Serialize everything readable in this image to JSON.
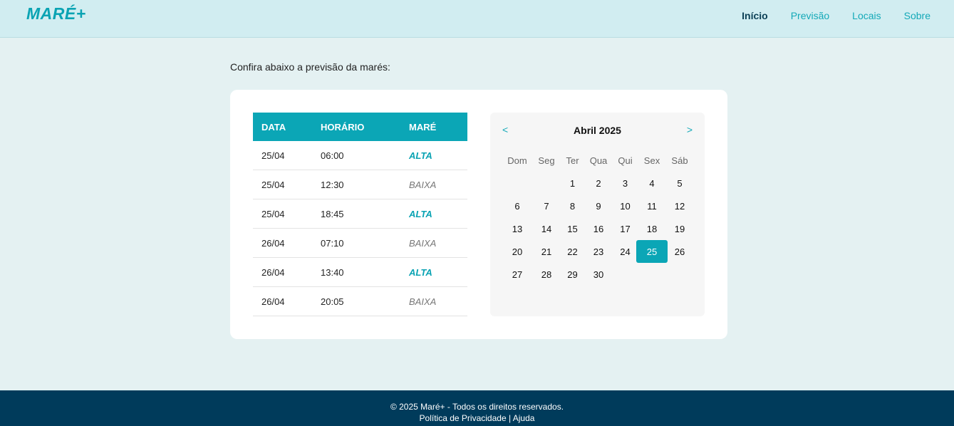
{
  "header": {
    "logo": "MARÉ+",
    "nav": [
      "Início",
      "Previsão",
      "Locais",
      "Sobre"
    ]
  },
  "intro": "Confira abaixo a previsão da marés:",
  "table": {
    "headers": [
      "DATA",
      "HORÁRIO",
      "MARÉ"
    ],
    "rows": [
      {
        "date": "25/04",
        "time": "06:00",
        "tide": "ALTA"
      },
      {
        "date": "25/04",
        "time": "12:30",
        "tide": "BAIXA"
      },
      {
        "date": "25/04",
        "time": "18:45",
        "tide": "ALTA"
      },
      {
        "date": "26/04",
        "time": "07:10",
        "tide": "BAIXA"
      },
      {
        "date": "26/04",
        "time": "13:40",
        "tide": "ALTA"
      },
      {
        "date": "26/04",
        "time": "20:05",
        "tide": "BAIXA"
      }
    ]
  },
  "calendar": {
    "prev": "<",
    "next": ">",
    "title": "Abril 2025",
    "weekdays": [
      "Dom",
      "Seg",
      "Ter",
      "Qua",
      "Qui",
      "Sex",
      "Sáb"
    ],
    "first_weekday_index": 2,
    "days_in_month": 30,
    "selected_day": 25
  },
  "footer": {
    "copyright": "© 2025 Maré+ - Todos os direitos reservados.",
    "privacy": "Política de Privacidade",
    "separator": " | ",
    "help": "Ajuda"
  }
}
